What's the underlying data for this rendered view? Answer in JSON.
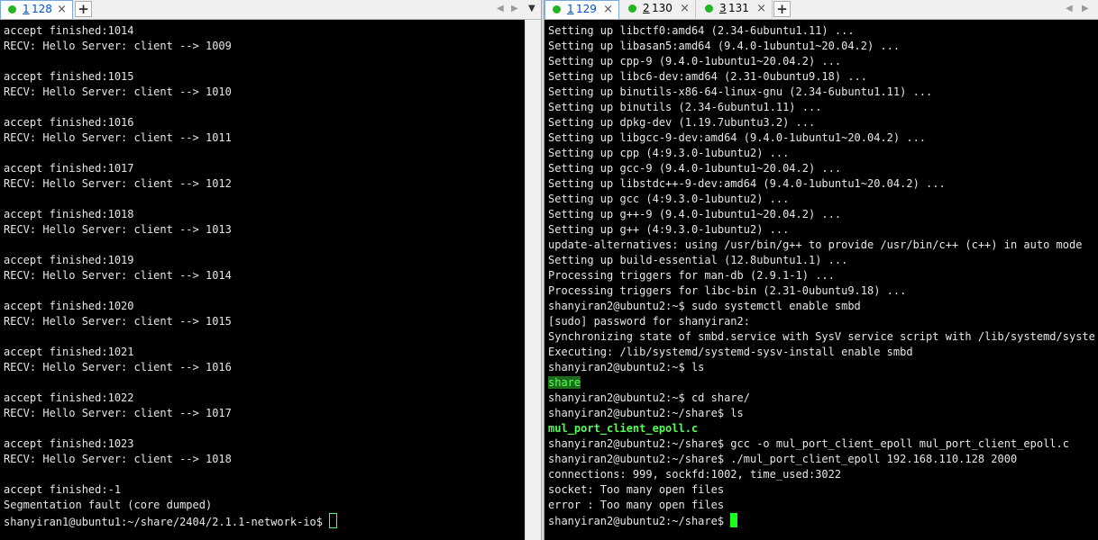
{
  "left_tabs": [
    {
      "num": "1",
      "id": "128",
      "close": "×"
    }
  ],
  "right_tabs": [
    {
      "num": "1",
      "id": "129",
      "close": "×"
    },
    {
      "num": "2",
      "id": "130",
      "close": "×"
    },
    {
      "num": "3",
      "id": "131",
      "close": "×"
    }
  ],
  "left_terminal": {
    "lines": [
      "accept finished:1014",
      "RECV: Hello Server: client --> 1009",
      "",
      "accept finished:1015",
      "RECV: Hello Server: client --> 1010",
      "",
      "accept finished:1016",
      "RECV: Hello Server: client --> 1011",
      "",
      "accept finished:1017",
      "RECV: Hello Server: client --> 1012",
      "",
      "accept finished:1018",
      "RECV: Hello Server: client --> 1013",
      "",
      "accept finished:1019",
      "RECV: Hello Server: client --> 1014",
      "",
      "accept finished:1020",
      "RECV: Hello Server: client --> 1015",
      "",
      "accept finished:1021",
      "RECV: Hello Server: client --> 1016",
      "",
      "accept finished:1022",
      "RECV: Hello Server: client --> 1017",
      "",
      "accept finished:1023",
      "RECV: Hello Server: client --> 1018",
      "",
      "accept finished:-1",
      "Segmentation fault (core dumped)"
    ],
    "prompt": "shanyiran1@ubuntu1:~/share/2404/2.1.1-network-io$ "
  },
  "right_terminal": {
    "lines_a": [
      "Setting up libctf0:amd64 (2.34-6ubuntu1.11) ...",
      "Setting up libasan5:amd64 (9.4.0-1ubuntu1~20.04.2) ...",
      "Setting up cpp-9 (9.4.0-1ubuntu1~20.04.2) ...",
      "Setting up libc6-dev:amd64 (2.31-0ubuntu9.18) ...",
      "Setting up binutils-x86-64-linux-gnu (2.34-6ubuntu1.11) ...",
      "Setting up binutils (2.34-6ubuntu1.11) ...",
      "Setting up dpkg-dev (1.19.7ubuntu3.2) ...",
      "Setting up libgcc-9-dev:amd64 (9.4.0-1ubuntu1~20.04.2) ...",
      "Setting up cpp (4:9.3.0-1ubuntu2) ...",
      "Setting up gcc-9 (9.4.0-1ubuntu1~20.04.2) ...",
      "Setting up libstdc++-9-dev:amd64 (9.4.0-1ubuntu1~20.04.2) ...",
      "Setting up gcc (4:9.3.0-1ubuntu2) ...",
      "Setting up g++-9 (9.4.0-1ubuntu1~20.04.2) ...",
      "Setting up g++ (4:9.3.0-1ubuntu2) ...",
      "update-alternatives: using /usr/bin/g++ to provide /usr/bin/c++ (c++) in auto mode",
      "Setting up build-essential (12.8ubuntu1.1) ...",
      "Processing triggers for man-db (2.9.1-1) ...",
      "Processing triggers for libc-bin (2.31-0ubuntu9.18) ...",
      "shanyiran2@ubuntu2:~$ sudo systemctl enable smbd",
      "[sudo] password for shanyiran2:",
      "Synchronizing state of smbd.service with SysV service script with /lib/systemd/systemd-sysv-install.",
      "Executing: /lib/systemd/systemd-sysv-install enable smbd",
      "shanyiran2@ubuntu2:~$ ls"
    ],
    "dir_listing": "share",
    "lines_b": [
      "shanyiran2@ubuntu2:~$ cd share/",
      "shanyiran2@ubuntu2:~/share$ ls"
    ],
    "file_listing": "mul_port_client_epoll.c",
    "lines_c": [
      "shanyiran2@ubuntu2:~/share$ gcc -o mul_port_client_epoll mul_port_client_epoll.c",
      "shanyiran2@ubuntu2:~/share$ ./mul_port_client_epoll 192.168.110.128 2000",
      "connections: 999, sockfd:1002, time_used:3022",
      "socket: Too many open files",
      "error : Too many open files"
    ],
    "prompt": "shanyiran2@ubuntu2:~/share$ "
  },
  "colors": {
    "terminal_bg": "#000000",
    "terminal_fg": "#e6e6e6",
    "accent_green": "#54ff54",
    "active_tab_text": "#0050d0"
  },
  "icons": {
    "add_tab": "+",
    "nav_left": "◀",
    "nav_right": "▶",
    "dropdown": "▼"
  }
}
